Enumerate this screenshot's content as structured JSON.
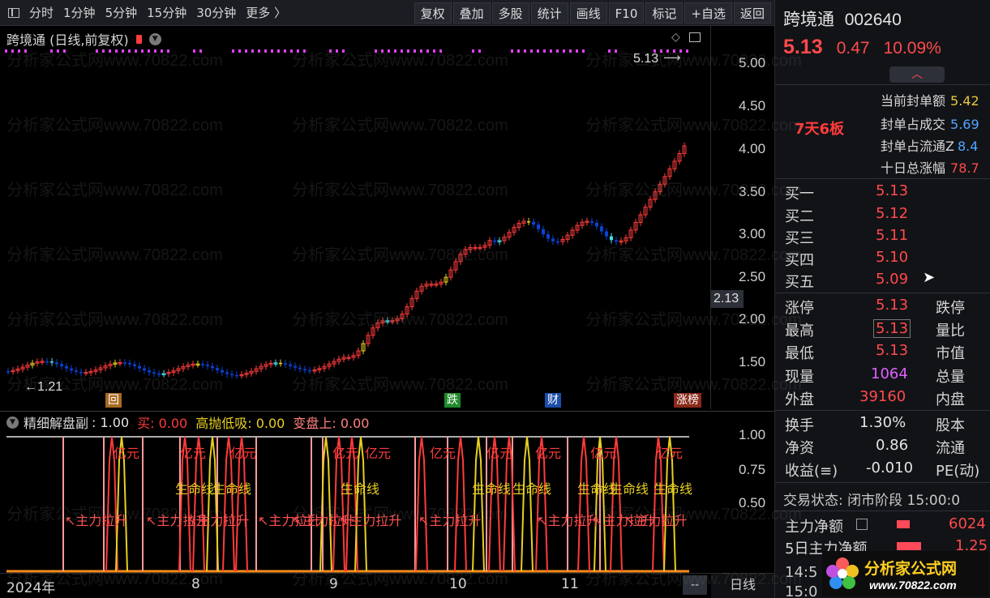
{
  "toolbar": {
    "left_items": [
      "分时",
      "1分钟",
      "5分钟",
      "15分钟",
      "30分钟",
      "更多 〉"
    ],
    "buttons": [
      "复权",
      "叠加",
      "多股",
      "统计",
      "画线",
      "F10",
      "标记",
      "+自选",
      "返回"
    ]
  },
  "chart_header": {
    "title": "跨境通 (日线,前复权)"
  },
  "price_axis": {
    "labels": [
      "5.00",
      "4.50",
      "4.00",
      "3.50",
      "3.00",
      "2.50",
      "2.00",
      "1.50"
    ],
    "current_marker": "2.13"
  },
  "annotations": {
    "high_price": "5.13",
    "low_price": "←1.21",
    "event_tags": [
      "回",
      "跌",
      "财",
      "涨榜"
    ]
  },
  "indicator": {
    "title": "精细解盘副",
    "main_value": ": 1.00",
    "buy_label": "买: 0.00",
    "hold_label": "高抛低吸: 0.00",
    "change_label": "变盘上: 0.00",
    "axis_labels": [
      "1.00",
      "0.75",
      "0.50"
    ],
    "texts": {
      "yiyuan": "亿元",
      "lifeline": "生命线",
      "pull_up": "↖主力拉升"
    }
  },
  "date_axis": {
    "labels": [
      "2024年",
      "8",
      "9",
      "10",
      "11"
    ],
    "end": "--",
    "period": "日线"
  },
  "stock": {
    "name": "跨境通",
    "code": "002640",
    "price": "5.13",
    "change": "0.47",
    "change_pct": "10.09%"
  },
  "limit_info": {
    "streak": "7天6板",
    "rows": [
      {
        "label": "当前封单额",
        "value": "5.42",
        "color": "yel"
      },
      {
        "label": "封单占成交",
        "value": "5.69",
        "color": "blu"
      },
      {
        "label": "封单占流通Z",
        "value": "8.4",
        "color": "blu"
      },
      {
        "label": "十日总涨幅",
        "value": "78.7",
        "color": "red"
      }
    ]
  },
  "order_book": [
    {
      "label": "买一",
      "price": "5.13"
    },
    {
      "label": "买二",
      "price": "5.12"
    },
    {
      "label": "买三",
      "price": "5.11"
    },
    {
      "label": "买四",
      "price": "5.10"
    },
    {
      "label": "买五",
      "price": "5.09"
    }
  ],
  "quote": [
    {
      "label": "涨停",
      "value": "5.13",
      "color": "red",
      "label2": "跌停"
    },
    {
      "label": "最高",
      "value": "5.13",
      "color": "red",
      "label2": "量比"
    },
    {
      "label": "最低",
      "value": "5.13",
      "color": "red",
      "label2": "市值"
    },
    {
      "label": "现量",
      "value": "1064",
      "color": "mag",
      "label2": "总量"
    },
    {
      "label": "外盘",
      "value": "39160",
      "color": "red",
      "label2": "内盘"
    }
  ],
  "fundamentals": [
    {
      "label": "换手",
      "value": "1.30%",
      "label2": "股本"
    },
    {
      "label": "净资",
      "value": "0.86",
      "label2": "流通"
    },
    {
      "label": "收益(≡)",
      "value": "-0.010",
      "label2": "PE(动)"
    }
  ],
  "trade_status": "交易状态: 闭市阶段 15:00:0",
  "capital_flow": [
    {
      "label": "主力净额",
      "value": "6024",
      "icon": "table-icon"
    },
    {
      "label": "5日主力净额",
      "value": "1.25"
    }
  ],
  "time_rows": [
    "14:5",
    "15:0"
  ],
  "watermark": {
    "text": "分析家公式网www.70822.com",
    "logo_text": "分析家公式网",
    "logo_url": "www.70822.com"
  },
  "colors": {
    "up": "#ff3b3b",
    "down": "#0a42d8",
    "yellow": "#e8d020",
    "cyan": "#40e0f0",
    "magenta": "#e040ff",
    "bg": "#000000"
  }
}
